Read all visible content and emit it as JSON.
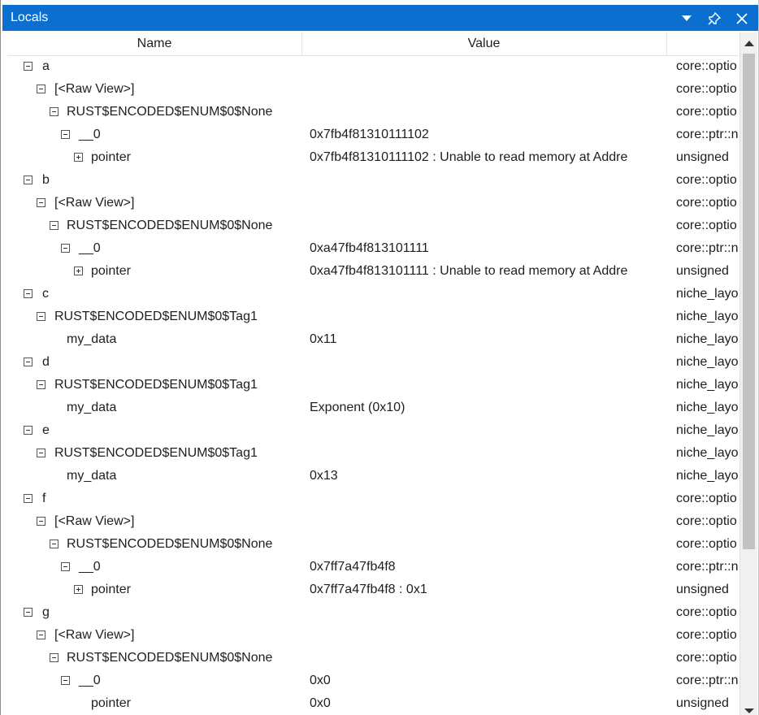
{
  "window": {
    "title": "Locals"
  },
  "columns": {
    "name": "Name",
    "value": "Value",
    "type": ""
  },
  "rows": [
    {
      "level": 0,
      "toggle": "expanded",
      "name": "a",
      "value": "",
      "type": "core::optio"
    },
    {
      "level": 1,
      "toggle": "expanded",
      "name": "[<Raw View>]",
      "value": "",
      "type": "core::optio"
    },
    {
      "level": 2,
      "toggle": "expanded",
      "name": "RUST$ENCODED$ENUM$0$None",
      "value": "",
      "type": "core::optio"
    },
    {
      "level": 3,
      "toggle": "expanded",
      "name": "__0",
      "value": "0x7fb4f81310111102",
      "type": "core::ptr::n"
    },
    {
      "level": 4,
      "toggle": "collapsed",
      "name": "pointer",
      "value": "0x7fb4f81310111102 : Unable to read memory at Addre",
      "type": "unsigned"
    },
    {
      "level": 0,
      "toggle": "expanded",
      "name": "b",
      "value": "",
      "type": "core::optio"
    },
    {
      "level": 1,
      "toggle": "expanded",
      "name": "[<Raw View>]",
      "value": "",
      "type": "core::optio"
    },
    {
      "level": 2,
      "toggle": "expanded",
      "name": "RUST$ENCODED$ENUM$0$None",
      "value": "",
      "type": "core::optio"
    },
    {
      "level": 3,
      "toggle": "expanded",
      "name": "__0",
      "value": "0xa47fb4f813101111",
      "type": "core::ptr::n"
    },
    {
      "level": 4,
      "toggle": "collapsed",
      "name": "pointer",
      "value": "0xa47fb4f813101111 : Unable to read memory at Addre",
      "type": "unsigned"
    },
    {
      "level": 0,
      "toggle": "expanded",
      "name": "c",
      "value": "",
      "type": "niche_layo"
    },
    {
      "level": 1,
      "toggle": "expanded",
      "name": "RUST$ENCODED$ENUM$0$Tag1",
      "value": "",
      "type": "niche_layo"
    },
    {
      "level": 2,
      "toggle": "none",
      "name": "my_data",
      "value": "0x11",
      "type": "niche_layo"
    },
    {
      "level": 0,
      "toggle": "expanded",
      "name": "d",
      "value": "",
      "type": "niche_layo"
    },
    {
      "level": 1,
      "toggle": "expanded",
      "name": "RUST$ENCODED$ENUM$0$Tag1",
      "value": "",
      "type": "niche_layo"
    },
    {
      "level": 2,
      "toggle": "none",
      "name": "my_data",
      "value": "Exponent (0x10)",
      "type": "niche_layo"
    },
    {
      "level": 0,
      "toggle": "expanded",
      "name": "e",
      "value": "",
      "type": "niche_layo"
    },
    {
      "level": 1,
      "toggle": "expanded",
      "name": "RUST$ENCODED$ENUM$0$Tag1",
      "value": "",
      "type": "niche_layo"
    },
    {
      "level": 2,
      "toggle": "none",
      "name": "my_data",
      "value": "0x13",
      "type": "niche_layo"
    },
    {
      "level": 0,
      "toggle": "expanded",
      "name": "f",
      "value": "",
      "type": "core::optio"
    },
    {
      "level": 1,
      "toggle": "expanded",
      "name": "[<Raw View>]",
      "value": "",
      "type": "core::optio"
    },
    {
      "level": 2,
      "toggle": "expanded",
      "name": "RUST$ENCODED$ENUM$0$None",
      "value": "",
      "type": "core::optio"
    },
    {
      "level": 3,
      "toggle": "expanded",
      "name": "__0",
      "value": "0x7ff7a47fb4f8",
      "type": "core::ptr::n"
    },
    {
      "level": 4,
      "toggle": "collapsed",
      "name": "pointer",
      "value": "0x7ff7a47fb4f8 : 0x1",
      "type": "unsigned"
    },
    {
      "level": 0,
      "toggle": "expanded",
      "name": "g",
      "value": "",
      "type": "core::optio"
    },
    {
      "level": 1,
      "toggle": "expanded",
      "name": "[<Raw View>]",
      "value": "",
      "type": "core::optio"
    },
    {
      "level": 2,
      "toggle": "expanded",
      "name": "RUST$ENCODED$ENUM$0$None",
      "value": "",
      "type": "core::optio"
    },
    {
      "level": 3,
      "toggle": "expanded",
      "name": "__0",
      "value": "0x0",
      "type": "core::ptr::n"
    },
    {
      "level": 4,
      "toggle": "none",
      "name": "pointer",
      "value": "0x0",
      "type": "unsigned"
    }
  ],
  "icons": {
    "dropdown": "chevron-down-icon",
    "pin": "pin-icon",
    "close": "close-icon",
    "expanded": "minus-box-icon",
    "collapsed": "plus-box-icon"
  },
  "colors": {
    "titlebar": "#0a6fce",
    "text": "#1e1e1e",
    "scrollbar_thumb": "#c2c2c2"
  }
}
